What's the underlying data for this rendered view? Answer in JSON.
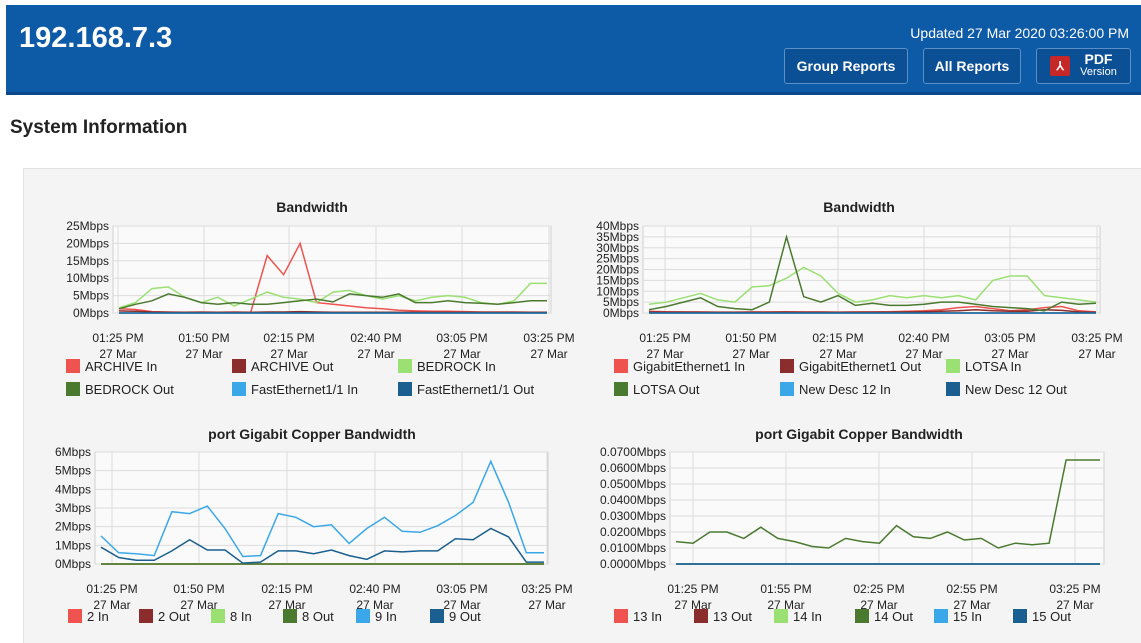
{
  "header": {
    "host": "192.168.7.3",
    "updated": "Updated 27 Mar 2020 03:26:00 PM",
    "buttons": {
      "group_reports": "Group Reports",
      "all_reports": "All Reports",
      "pdf_main": "PDF",
      "pdf_sub": "Version"
    },
    "background_color": "#0d5aa7"
  },
  "section_title": "System Information",
  "chart_data": [
    {
      "type": "line",
      "title": "Bandwidth",
      "y_ticks": [
        "25Mbps",
        "20Mbps",
        "15Mbps",
        "10Mbps",
        "5Mbps",
        "0Mbps"
      ],
      "ylim": [
        0,
        25
      ],
      "x_ticks": [
        {
          "time": "01:25 PM",
          "date": "27 Mar"
        },
        {
          "time": "01:50 PM",
          "date": "27 Mar"
        },
        {
          "time": "02:15 PM",
          "date": "27 Mar"
        },
        {
          "time": "02:40 PM",
          "date": "27 Mar"
        },
        {
          "time": "03:05 PM",
          "date": "27 Mar"
        },
        {
          "time": "03:25 PM",
          "date": "27 Mar"
        }
      ],
      "series": [
        {
          "name": "ARCHIVE In",
          "color": "#ef5350",
          "values": [
            1.2,
            1.0,
            0.4,
            0.3,
            0.2,
            0.3,
            0.2,
            0.3,
            0.2,
            16.5,
            11,
            20,
            3,
            2.5,
            2,
            1.5,
            1.2,
            0.8,
            0.6,
            0.5,
            0.5,
            0.4,
            0.3,
            0.3,
            0.3,
            0.2,
            0.2
          ]
        },
        {
          "name": "ARCHIVE Out",
          "color": "#8b2d2d",
          "values": [
            0.6,
            0.5,
            0.3,
            0.2,
            0.2,
            0.2,
            0.2,
            0.2,
            0.2,
            0.3,
            0.3,
            0.4,
            0.3,
            0.2,
            0.2,
            0.2,
            0.2,
            0.2,
            0.2,
            0.2,
            0.2,
            0.2,
            0.2,
            0.2,
            0.2,
            0.2,
            0.2
          ]
        },
        {
          "name": "BEDROCK In",
          "color": "#9ae072",
          "values": [
            1.5,
            3,
            7,
            7.5,
            4.5,
            3,
            4.5,
            2,
            4,
            6,
            4.5,
            4,
            3,
            6,
            6.5,
            5,
            4,
            5,
            3.5,
            4.5,
            5,
            4.5,
            3,
            2.5,
            3.5,
            8.5,
            8.5
          ]
        },
        {
          "name": "BEDROCK Out",
          "color": "#4a7a2f",
          "values": [
            1.2,
            2.5,
            3.5,
            5.5,
            4.5,
            3,
            2.5,
            3,
            2.5,
            2.5,
            3,
            3.5,
            4,
            3.2,
            5.5,
            5,
            4.5,
            5.5,
            3,
            3,
            3.5,
            3,
            2.8,
            2.5,
            3,
            3.5,
            3.5
          ]
        },
        {
          "name": "FastEthernet1/1 In",
          "color": "#3aa8e8",
          "values": [
            0,
            0,
            0,
            0,
            0,
            0,
            0,
            0,
            0,
            0,
            0,
            0,
            0,
            0,
            0,
            0,
            0,
            0,
            0,
            0,
            0,
            0,
            0,
            0,
            0,
            0,
            0
          ]
        },
        {
          "name": "FastEthernet1/1 Out",
          "color": "#1a5f8f",
          "values": [
            0,
            0,
            0,
            0,
            0,
            0,
            0,
            0,
            0,
            0,
            0,
            0,
            0,
            0,
            0,
            0,
            0,
            0,
            0,
            0,
            0,
            0,
            0,
            0,
            0,
            0,
            0
          ]
        }
      ]
    },
    {
      "type": "line",
      "title": "Bandwidth",
      "y_ticks": [
        "40Mbps",
        "35Mbps",
        "30Mbps",
        "25Mbps",
        "20Mbps",
        "15Mbps",
        "10Mbps",
        "5Mbps",
        "0Mbps"
      ],
      "ylim": [
        0,
        40
      ],
      "x_ticks": [
        {
          "time": "01:25 PM",
          "date": "27 Mar"
        },
        {
          "time": "01:50 PM",
          "date": "27 Mar"
        },
        {
          "time": "02:15 PM",
          "date": "27 Mar"
        },
        {
          "time": "02:40 PM",
          "date": "27 Mar"
        },
        {
          "time": "03:05 PM",
          "date": "27 Mar"
        },
        {
          "time": "03:25 PM",
          "date": "27 Mar"
        }
      ],
      "series": [
        {
          "name": "GigabitEthernet1 In",
          "color": "#ef5350",
          "values": [
            0.8,
            0.6,
            0.5,
            0.5,
            0.4,
            0.4,
            0.5,
            0.5,
            0.6,
            0.5,
            0.5,
            0.4,
            0.5,
            0.5,
            0.6,
            0.8,
            1,
            1.5,
            2.5,
            3,
            2,
            1,
            1.5,
            2.5,
            3,
            1,
            0.5
          ]
        },
        {
          "name": "GigabitEthernet1 Out",
          "color": "#8b2d2d",
          "values": [
            0.5,
            0.4,
            0.4,
            0.3,
            0.3,
            0.3,
            0.3,
            0.3,
            0.4,
            0.3,
            0.3,
            0.3,
            0.3,
            0.4,
            0.4,
            0.5,
            0.6,
            0.8,
            1,
            1.5,
            1,
            0.8,
            0.8,
            1.5,
            1.2,
            0.5,
            0.3
          ]
        },
        {
          "name": "LOTSA In",
          "color": "#9ae072",
          "values": [
            4,
            5,
            7,
            9,
            6,
            5,
            12,
            12.5,
            16,
            21,
            17,
            9,
            5,
            6,
            8,
            7,
            8,
            7,
            8,
            6,
            15,
            17,
            17,
            8,
            7,
            6,
            5
          ]
        },
        {
          "name": "LOTSA Out",
          "color": "#4a7a2f",
          "values": [
            1.5,
            3,
            5,
            7,
            3,
            2,
            1.5,
            5,
            35,
            7.5,
            5,
            8,
            3.5,
            4.5,
            3.5,
            3.5,
            4,
            5,
            5,
            4,
            3,
            2.5,
            2,
            1,
            5,
            4,
            4.5
          ]
        },
        {
          "name": "New Desc 12 In",
          "color": "#3aa8e8",
          "values": [
            0,
            0,
            0,
            0,
            0,
            0,
            0,
            0,
            0,
            0,
            0,
            0,
            0,
            0,
            0,
            0,
            0,
            0,
            0,
            0,
            0,
            0,
            0,
            0,
            0,
            0,
            0
          ]
        },
        {
          "name": "New Desc 12 Out",
          "color": "#1a5f8f",
          "values": [
            0,
            0,
            0,
            0,
            0,
            0,
            0,
            0,
            0,
            0,
            0,
            0,
            0,
            0,
            0,
            0,
            0,
            0,
            0,
            0,
            0,
            0,
            0,
            0,
            0,
            0,
            0
          ]
        }
      ]
    },
    {
      "type": "line",
      "title": "port Gigabit Copper Bandwidth",
      "y_ticks": [
        "6Mbps",
        "5Mbps",
        "4Mbps",
        "3Mbps",
        "2Mbps",
        "1Mbps",
        "0Mbps"
      ],
      "ylim": [
        0,
        6
      ],
      "x_ticks": [
        {
          "time": "01:25 PM",
          "date": "27 Mar"
        },
        {
          "time": "01:50 PM",
          "date": "27 Mar"
        },
        {
          "time": "02:15 PM",
          "date": "27 Mar"
        },
        {
          "time": "02:40 PM",
          "date": "27 Mar"
        },
        {
          "time": "03:05 PM",
          "date": "27 Mar"
        },
        {
          "time": "03:25 PM",
          "date": "27 Mar"
        }
      ],
      "series": [
        {
          "name": "2 In",
          "color": "#ef5350",
          "values": [
            0,
            0,
            0,
            0,
            0,
            0,
            0,
            0,
            0,
            0,
            0,
            0,
            0,
            0,
            0,
            0,
            0,
            0,
            0,
            0,
            0,
            0,
            0,
            0,
            0,
            0
          ]
        },
        {
          "name": "2 Out",
          "color": "#8b2d2d",
          "values": [
            0,
            0,
            0,
            0,
            0,
            0,
            0,
            0,
            0,
            0,
            0,
            0,
            0,
            0,
            0,
            0,
            0,
            0,
            0,
            0,
            0,
            0,
            0,
            0,
            0,
            0
          ]
        },
        {
          "name": "8 In",
          "color": "#9ae072",
          "values": [
            0,
            0,
            0,
            0,
            0,
            0,
            0,
            0,
            0,
            0,
            0,
            0,
            0,
            0,
            0,
            0,
            0,
            0,
            0,
            0,
            0,
            0,
            0,
            0,
            0,
            0
          ]
        },
        {
          "name": "8 Out",
          "color": "#4a7a2f",
          "values": [
            0,
            0,
            0,
            0,
            0,
            0,
            0,
            0,
            0,
            0,
            0,
            0,
            0,
            0,
            0,
            0,
            0,
            0,
            0,
            0,
            0,
            0,
            0,
            0,
            0,
            0
          ]
        },
        {
          "name": "9 In",
          "color": "#3aa8e8",
          "values": [
            1.5,
            0.6,
            0.55,
            0.45,
            2.8,
            2.7,
            3.1,
            1.9,
            0.4,
            0.45,
            2.7,
            2.5,
            2,
            2.1,
            1.1,
            1.9,
            2.5,
            1.75,
            1.7,
            2.05,
            2.6,
            3.3,
            5.5,
            3.3,
            0.6,
            0.6
          ]
        },
        {
          "name": "9 Out",
          "color": "#1a5f8f",
          "values": [
            0.9,
            0.35,
            0.2,
            0.2,
            0.7,
            1.3,
            0.75,
            0.75,
            0.05,
            0.1,
            0.7,
            0.7,
            0.55,
            0.75,
            0.45,
            0.25,
            0.7,
            0.65,
            0.7,
            0.7,
            1.35,
            1.3,
            1.9,
            1.45,
            0.1,
            0.1
          ]
        }
      ]
    },
    {
      "type": "line",
      "title": "port Gigabit Copper Bandwidth",
      "y_ticks": [
        "0.0700Mbps",
        "0.0600Mbps",
        "0.0500Mbps",
        "0.0400Mbps",
        "0.0300Mbps",
        "0.0200Mbps",
        "0.0100Mbps",
        "0.0000Mbps"
      ],
      "ylim": [
        0,
        0.07
      ],
      "x_ticks": [
        {
          "time": "01:25 PM",
          "date": "27 Mar"
        },
        {
          "time": "01:55 PM",
          "date": "27 Mar"
        },
        {
          "time": "02:25 PM",
          "date": "27 Mar"
        },
        {
          "time": "02:55 PM",
          "date": "27 Mar"
        },
        {
          "time": "03:25 PM",
          "date": "27 Mar"
        }
      ],
      "series": [
        {
          "name": "13 In",
          "color": "#ef5350",
          "values": [
            0,
            0,
            0,
            0,
            0,
            0,
            0,
            0,
            0,
            0,
            0,
            0,
            0,
            0,
            0,
            0,
            0,
            0,
            0,
            0,
            0,
            0,
            0,
            0,
            0,
            0
          ]
        },
        {
          "name": "13 Out",
          "color": "#8b2d2d",
          "values": [
            0,
            0,
            0,
            0,
            0,
            0,
            0,
            0,
            0,
            0,
            0,
            0,
            0,
            0,
            0,
            0,
            0,
            0,
            0,
            0,
            0,
            0,
            0,
            0,
            0,
            0
          ]
        },
        {
          "name": "14 In",
          "color": "#9ae072",
          "values": [
            0,
            0,
            0,
            0,
            0,
            0,
            0,
            0,
            0,
            0,
            0,
            0,
            0,
            0,
            0,
            0,
            0,
            0,
            0,
            0,
            0,
            0,
            0,
            0,
            0,
            0
          ]
        },
        {
          "name": "14 Out",
          "color": "#4a7a2f",
          "values": [
            0.014,
            0.013,
            0.02,
            0.02,
            0.016,
            0.023,
            0.016,
            0.014,
            0.011,
            0.01,
            0.016,
            0.014,
            0.013,
            0.024,
            0.017,
            0.016,
            0.02,
            0.015,
            0.016,
            0.01,
            0.013,
            0.012,
            0.013,
            0.065,
            0.065,
            0.065
          ]
        },
        {
          "name": "15 In",
          "color": "#3aa8e8",
          "values": [
            0,
            0,
            0,
            0,
            0,
            0,
            0,
            0,
            0,
            0,
            0,
            0,
            0,
            0,
            0,
            0,
            0,
            0,
            0,
            0,
            0,
            0,
            0,
            0,
            0,
            0
          ]
        },
        {
          "name": "15 Out",
          "color": "#1a5f8f",
          "values": [
            0,
            0,
            0,
            0,
            0,
            0,
            0,
            0,
            0,
            0,
            0,
            0,
            0,
            0,
            0,
            0,
            0,
            0,
            0,
            0,
            0,
            0,
            0,
            0,
            0,
            0
          ]
        }
      ]
    }
  ]
}
